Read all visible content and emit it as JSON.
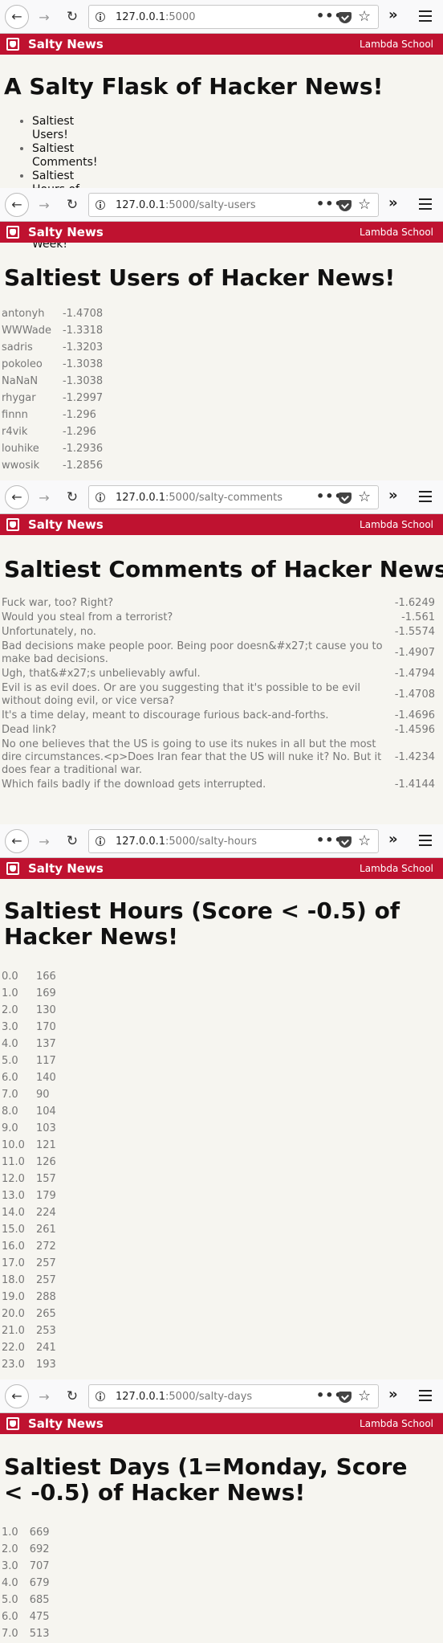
{
  "browser": {
    "host": "127.0.0.1",
    "more_label": "•••",
    "overflow_label": "»"
  },
  "app": {
    "brand": "Salty News",
    "link": "Lambda School"
  },
  "home": {
    "url_path": ":5000",
    "title": "A Salty Flask of Hacker News!",
    "links": [
      "Saltiest Users!",
      "Saltiest Comments!",
      "Saltiest Hours of the Day!",
      "Saltiest Days of the Week!"
    ]
  },
  "users": {
    "url_path": ":5000/salty-users",
    "title": "Saltiest Users of Hacker News!",
    "rows": [
      {
        "name": "antonyh",
        "score": "-1.4708"
      },
      {
        "name": "WWWade",
        "score": "-1.3318"
      },
      {
        "name": "sadris",
        "score": "-1.3203"
      },
      {
        "name": "pokoleo",
        "score": "-1.3038"
      },
      {
        "name": "NaNaN",
        "score": "-1.3038"
      },
      {
        "name": "rhygar",
        "score": "-1.2997"
      },
      {
        "name": "finnn",
        "score": "-1.296"
      },
      {
        "name": "r4vik",
        "score": "-1.296"
      },
      {
        "name": "louhike",
        "score": "-1.2936"
      },
      {
        "name": "wwosik",
        "score": "-1.2856"
      }
    ]
  },
  "comments": {
    "url_path": ":5000/salty-comments",
    "title": "Saltiest Comments of Hacker News!",
    "rows": [
      {
        "text": "Fuck war, too? Right?",
        "score": "-1.6249"
      },
      {
        "text": "Would you steal from a terrorist?",
        "score": "-1.561"
      },
      {
        "text": "Unfortunately, no.",
        "score": "-1.5574"
      },
      {
        "text": "Bad decisions make people poor. Being poor doesn&#x27;t cause you to make bad decisions.",
        "score": "-1.4907"
      },
      {
        "text": "Ugh, that&#x27;s unbelievably awful.",
        "score": "-1.4794"
      },
      {
        "text": "Evil is as evil does. Or are you suggesting that it's possible to be evil without doing evil, or vice versa?",
        "score": "-1.4708"
      },
      {
        "text": "It's a time delay, meant to discourage furious back-and-forths.",
        "score": "-1.4696"
      },
      {
        "text": "Dead link?",
        "score": "-1.4596"
      },
      {
        "text": "No one believes that the US is going to use its nukes in all but the most dire circumstances.<p>Does Iran fear that the US will nuke it? No. But it does fear a traditional war.",
        "score": "-1.4234"
      },
      {
        "text": "Which fails badly if the download gets interrupted.",
        "score": "-1.4144"
      }
    ]
  },
  "hours": {
    "url_path": ":5000/salty-hours",
    "title": "Saltiest Hours (Score < -0.5) of Hacker News!",
    "rows": [
      {
        "k": "0.0",
        "v": "166"
      },
      {
        "k": "1.0",
        "v": "169"
      },
      {
        "k": "2.0",
        "v": "130"
      },
      {
        "k": "3.0",
        "v": "170"
      },
      {
        "k": "4.0",
        "v": "137"
      },
      {
        "k": "5.0",
        "v": "117"
      },
      {
        "k": "6.0",
        "v": "140"
      },
      {
        "k": "7.0",
        "v": "90"
      },
      {
        "k": "8.0",
        "v": "104"
      },
      {
        "k": "9.0",
        "v": "103"
      },
      {
        "k": "10.0",
        "v": "121"
      },
      {
        "k": "11.0",
        "v": "126"
      },
      {
        "k": "12.0",
        "v": "157"
      },
      {
        "k": "13.0",
        "v": "179"
      },
      {
        "k": "14.0",
        "v": "224"
      },
      {
        "k": "15.0",
        "v": "261"
      },
      {
        "k": "16.0",
        "v": "272"
      },
      {
        "k": "17.0",
        "v": "257"
      },
      {
        "k": "18.0",
        "v": "257"
      },
      {
        "k": "19.0",
        "v": "288"
      },
      {
        "k": "20.0",
        "v": "265"
      },
      {
        "k": "21.0",
        "v": "253"
      },
      {
        "k": "22.0",
        "v": "241"
      },
      {
        "k": "23.0",
        "v": "193"
      }
    ]
  },
  "days": {
    "url_path": ":5000/salty-days",
    "title": "Saltiest Days (1=Monday, Score < -0.5) of Hacker News!",
    "rows": [
      {
        "k": "1.0",
        "v": "669"
      },
      {
        "k": "2.0",
        "v": "692"
      },
      {
        "k": "3.0",
        "v": "707"
      },
      {
        "k": "4.0",
        "v": "679"
      },
      {
        "k": "5.0",
        "v": "685"
      },
      {
        "k": "6.0",
        "v": "475"
      },
      {
        "k": "7.0",
        "v": "513"
      }
    ]
  }
}
